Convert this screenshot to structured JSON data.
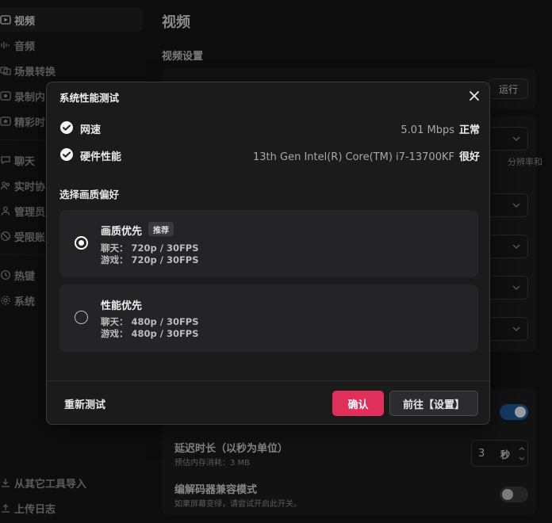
{
  "sidebar": {
    "items": [
      {
        "label": "视频",
        "icon": "play-icon"
      },
      {
        "label": "音频",
        "icon": "audio-icon"
      },
      {
        "label": "场景转换",
        "icon": "scene-icon"
      },
      {
        "label": "录制内",
        "icon": "record-icon"
      },
      {
        "label": "精彩时",
        "icon": "clip-icon"
      },
      {
        "label": "聊天",
        "icon": "chat-icon"
      },
      {
        "label": "实时协",
        "icon": "collab-icon"
      },
      {
        "label": "管理员",
        "icon": "admin-icon"
      },
      {
        "label": "受限账",
        "icon": "restricted-icon"
      },
      {
        "label": "热键",
        "icon": "hotkey-icon"
      },
      {
        "label": "系统",
        "icon": "system-icon"
      }
    ],
    "bottom_items": [
      {
        "label": "从其它工具导入",
        "icon": "import-icon"
      },
      {
        "label": "上传日志",
        "icon": "upload-icon"
      }
    ]
  },
  "main": {
    "title": "视频",
    "section_title": "视频设置",
    "run_label": "运行",
    "hint_text": "分辨率和",
    "delay": {
      "title": "延迟时长（以秒为单位）",
      "sub": "预估内存消耗：3 MB",
      "value": "3",
      "unit": "秒"
    },
    "codec": {
      "title": "编解码器兼容模式",
      "sub": "如果屏幕变绿，请尝试开启此开关。"
    }
  },
  "modal": {
    "title": "系统性能测试",
    "checks": [
      {
        "label": "网速",
        "value": "5.01 Mbps",
        "status": "正常"
      },
      {
        "label": "硬件性能",
        "value": "13th Gen Intel(R) Core(TM) i7-13700KF",
        "status": "很好"
      }
    ],
    "pref_title": "选择画质偏好",
    "options": [
      {
        "title": "画质优先",
        "badge": "推荐",
        "chat": "聊天：  720p / 30FPS",
        "game": "游戏：  720p / 30FPS",
        "selected": true
      },
      {
        "title": "性能优先",
        "badge": "",
        "chat": "聊天：  480p / 30FPS",
        "game": "游戏：  480p / 30FPS",
        "selected": false
      }
    ],
    "retest_label": "重新测试",
    "confirm_label": "确认",
    "settings_label": "前往【设置】"
  },
  "colors": {
    "accent": "#e0305a",
    "toggle_on": "#1e5a9a",
    "background": "#141414"
  }
}
